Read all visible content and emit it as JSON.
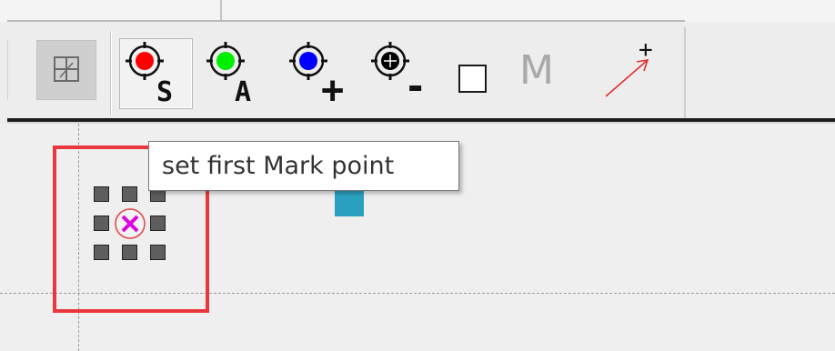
{
  "toolbar": {
    "tools": [
      {
        "name": "grid-layout",
        "icon": "grid-layout-icon",
        "label": ""
      },
      {
        "name": "set-start-mark",
        "icon": "target-red-icon",
        "label": "S",
        "color": "#ff0000"
      },
      {
        "name": "set-anchor-mark",
        "icon": "target-green-icon",
        "label": "A",
        "color": "#00ee00"
      },
      {
        "name": "add-mark",
        "icon": "target-blue-icon",
        "label": "+",
        "color": "#0000ff"
      },
      {
        "name": "remove-mark",
        "icon": "target-black-icon",
        "label": "-",
        "color": "#000000"
      },
      {
        "name": "rectangle",
        "icon": "square-icon",
        "label": ""
      },
      {
        "name": "mark",
        "icon": "m-icon",
        "label": "M"
      },
      {
        "name": "arrow",
        "icon": "arrow-plus-icon",
        "label": "+"
      }
    ]
  },
  "tooltip": {
    "text": "set first Mark point"
  },
  "canvas": {
    "selection_color": "#e8383d",
    "mark_color": "#e000e0",
    "marker_color": "#2aa0c0"
  }
}
